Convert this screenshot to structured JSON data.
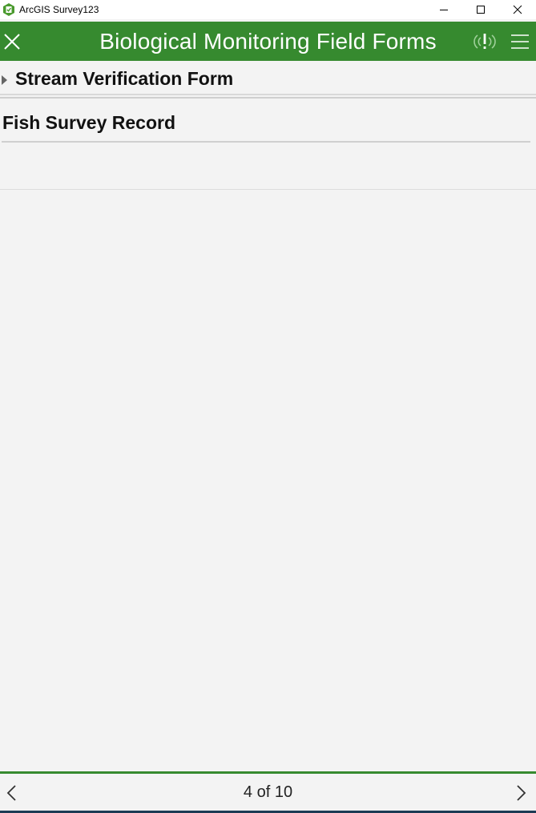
{
  "window": {
    "title": "ArcGIS Survey123",
    "icons": {
      "app": "survey123-app-icon",
      "minimize": "minimize-icon",
      "maximize": "maximize-icon",
      "close": "window-close-icon"
    }
  },
  "header": {
    "title": "Biological Monitoring Field Forms",
    "background": "#368a2f",
    "icons": {
      "close": "close-icon",
      "location": "location-alert-icon",
      "menu": "hamburger-menu-icon"
    }
  },
  "form": {
    "group": {
      "title": "Stream Verification Form",
      "icon": "collapsed-caret-icon"
    },
    "section": {
      "title": "Fish Survey Record"
    }
  },
  "footer": {
    "page_indicator": "4 of 10",
    "icons": {
      "prev": "chevron-left-icon",
      "next": "chevron-right-icon"
    }
  },
  "colors": {
    "accent": "#368a2f",
    "background": "#f3f3f3"
  }
}
